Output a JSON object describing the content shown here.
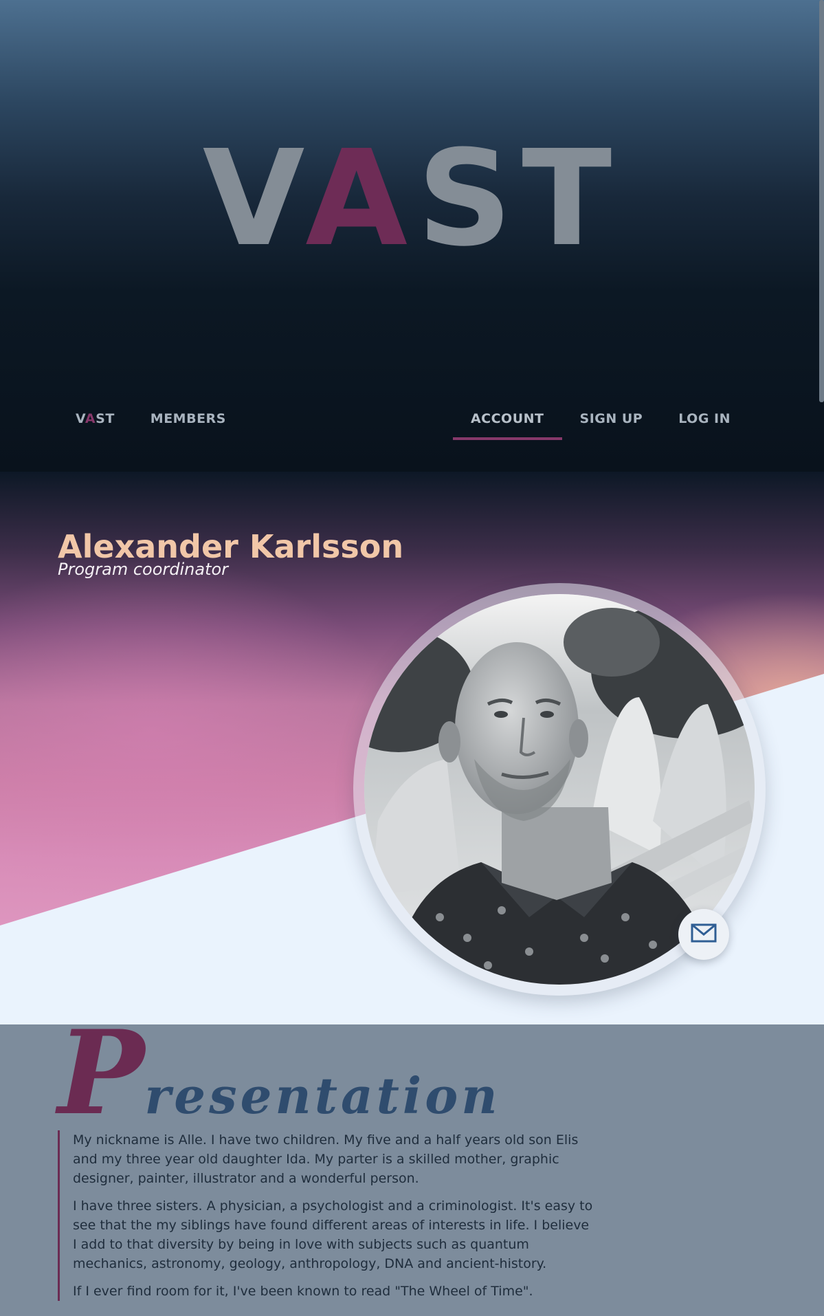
{
  "logo": {
    "pre": "V",
    "accent": "A",
    "post": "ST"
  },
  "nav": {
    "brand": {
      "pre": "V",
      "accent": "A",
      "post": "ST"
    },
    "left": [
      "MEMBERS"
    ],
    "right": [
      "ACCOUNT",
      "SIGN UP",
      "LOG IN"
    ],
    "active": "ACCOUNT"
  },
  "profile": {
    "name": "Alexander Karlsson",
    "role": "Program coordinator"
  },
  "presentation": {
    "drop_cap": "P",
    "title_rest": "resentation",
    "paragraphs": [
      "My nickname is Alle. I have two children. My five and a half years old son Elis and my three year old daughter Ida. My parter is a skilled mother, graphic designer, painter, illustrator and a wonderful person.",
      "I have three sisters. A physician, a psychologist and a criminologist. It's easy to see that the my siblings have found different areas of interests in life. I believe I add to that diversity by being in love with subjects such as quantum mechanics, astronomy, geology, anthropology, DNA and ancient-history.",
      "If I ever find room for it, I've been known to read \"The Wheel of Time\"."
    ]
  },
  "colors": {
    "accent": "#6e2c56",
    "name": "#f1c7a8",
    "light_panel": "#eaf3fd",
    "presentation_bg": "#7d8c9c"
  },
  "icons": {
    "mail": "envelope-icon"
  }
}
